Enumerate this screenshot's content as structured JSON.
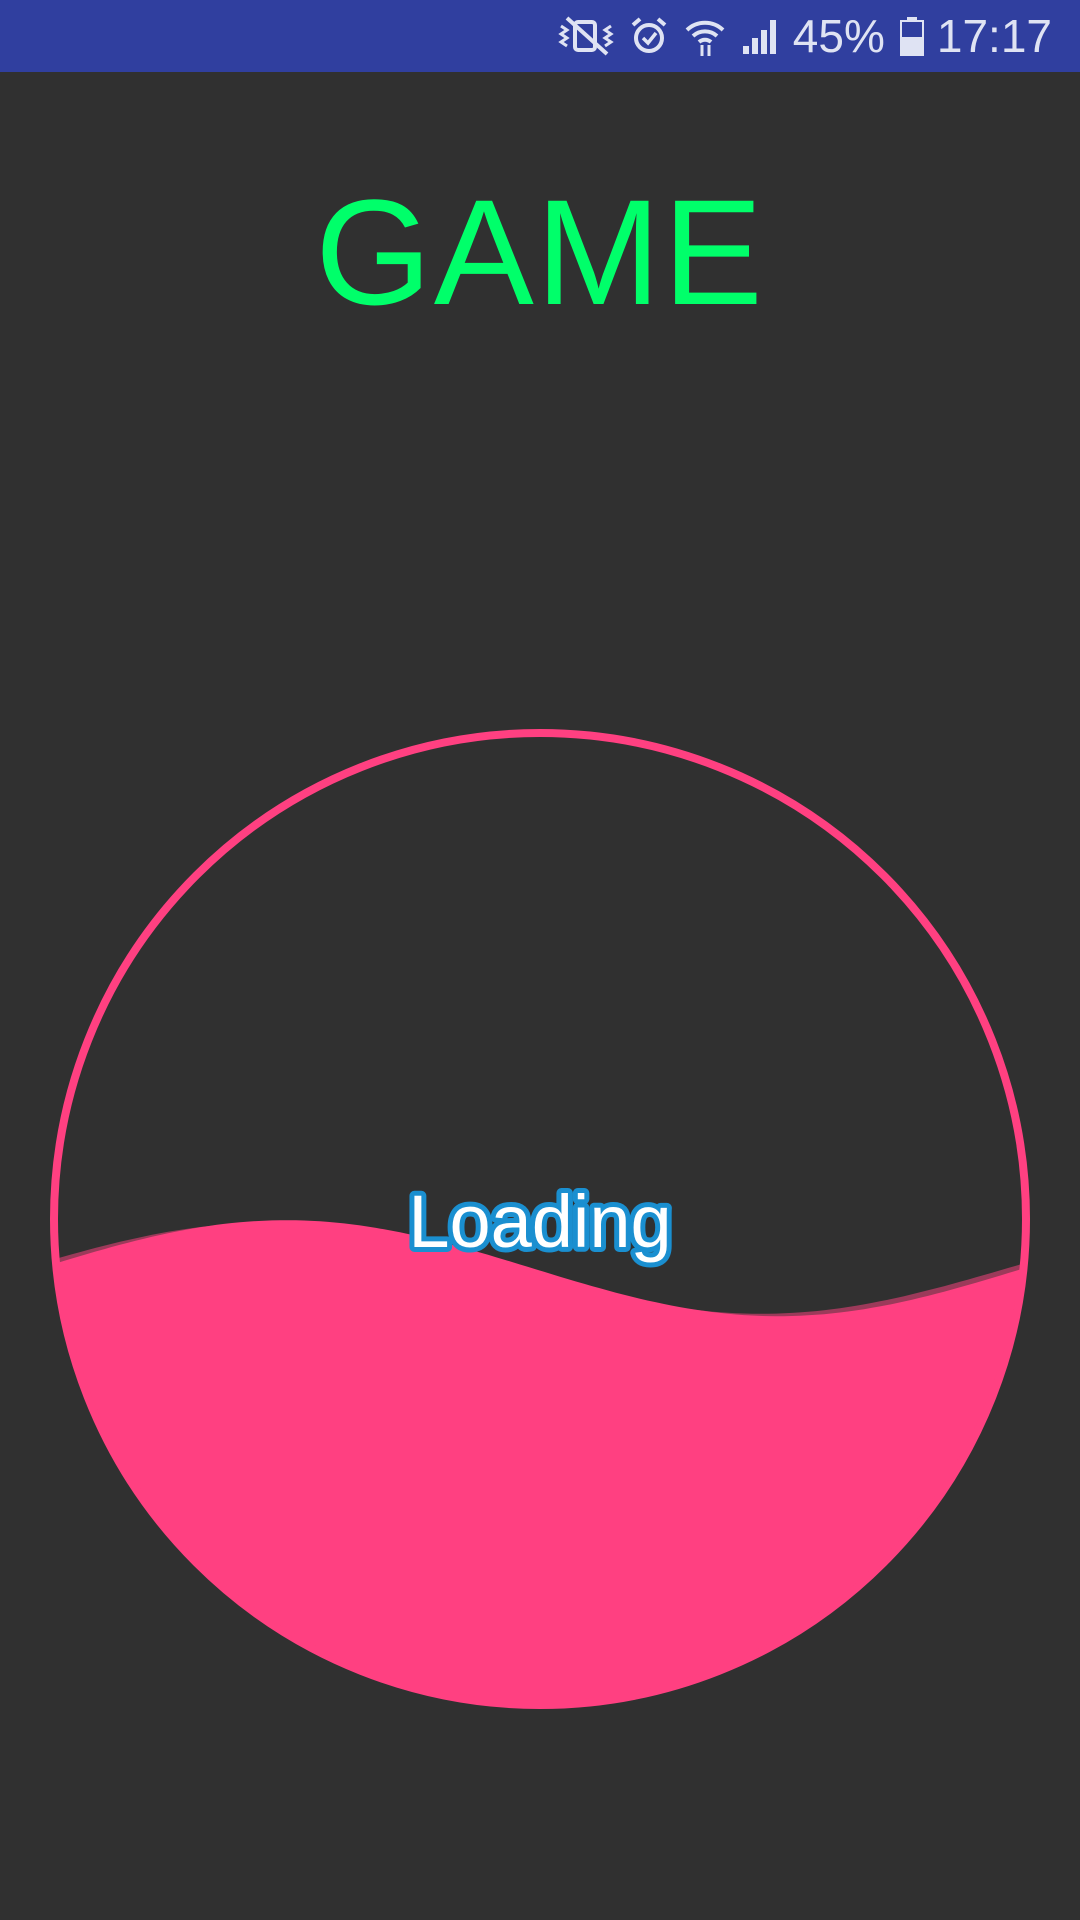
{
  "status_bar": {
    "background": "#303f9f",
    "icons": [
      "vibrate-mute-icon",
      "alarm-icon",
      "wifi-icon",
      "signal-icon",
      "battery-icon"
    ],
    "battery_percent": "45%",
    "time": "17:17"
  },
  "app": {
    "background": "#303030",
    "title": "GAME",
    "title_color": "#00ff6a"
  },
  "loader": {
    "label": "Loading",
    "progress": 0.45,
    "circle_color": "#ff4081",
    "back_wave_color": "#9c3a5a",
    "label_fill": "#ffffff",
    "label_stroke": "#1a8fd0"
  }
}
